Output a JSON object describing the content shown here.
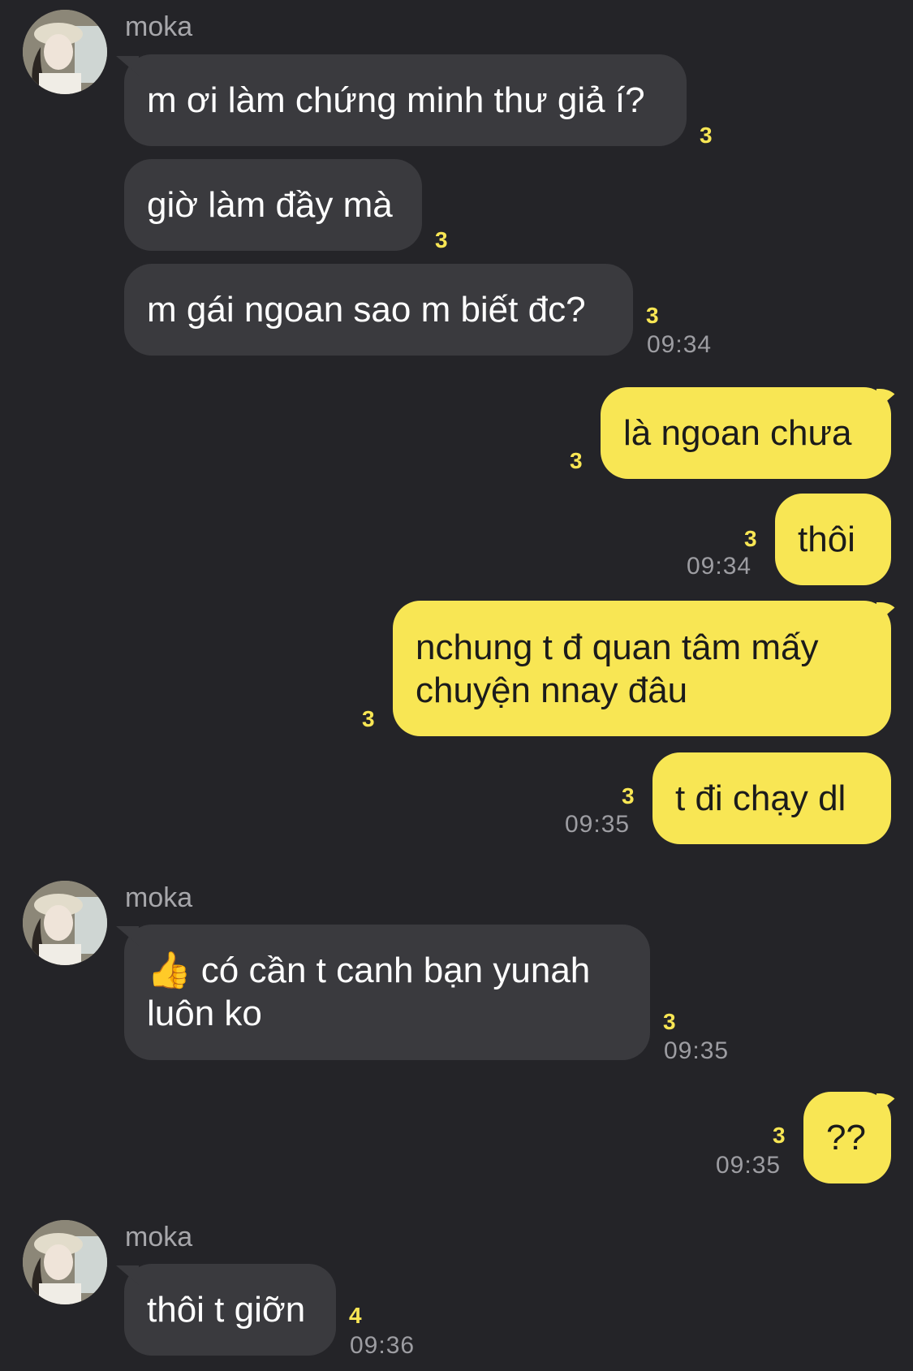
{
  "contact": {
    "name": "moka"
  },
  "messages": [
    {
      "text": "m ơi làm chứng minh thư giả í?",
      "unread": "3",
      "time": ""
    },
    {
      "text": "giờ làm đầy mà",
      "unread": "3",
      "time": ""
    },
    {
      "text": "m gái ngoan sao m biết đc?",
      "unread": "3",
      "time": "09:34"
    },
    {
      "text": "là ngoan chưa",
      "unread": "3",
      "time": ""
    },
    {
      "text": "thôi",
      "unread": "3",
      "time": "09:34"
    },
    {
      "text": "nchung t đ quan tâm mấy\nchuyện nnay đâu",
      "unread": "3",
      "time": ""
    },
    {
      "text": "t đi chạy dl",
      "unread": "3",
      "time": "09:35"
    },
    {
      "text": "có cần t canh bạn yunah\nluôn ko",
      "icon": "thumbs-up",
      "unread": "3",
      "time": "09:35"
    },
    {
      "text": "??",
      "unread": "3",
      "time": "09:35"
    },
    {
      "text": "thôi t giỡn",
      "unread": "4",
      "time": "09:36"
    }
  ],
  "colors": {
    "background": "#242428",
    "incoming_bubble": "#3a3a3e",
    "outgoing_bubble": "#f8e654",
    "unread": "#f8e654"
  }
}
